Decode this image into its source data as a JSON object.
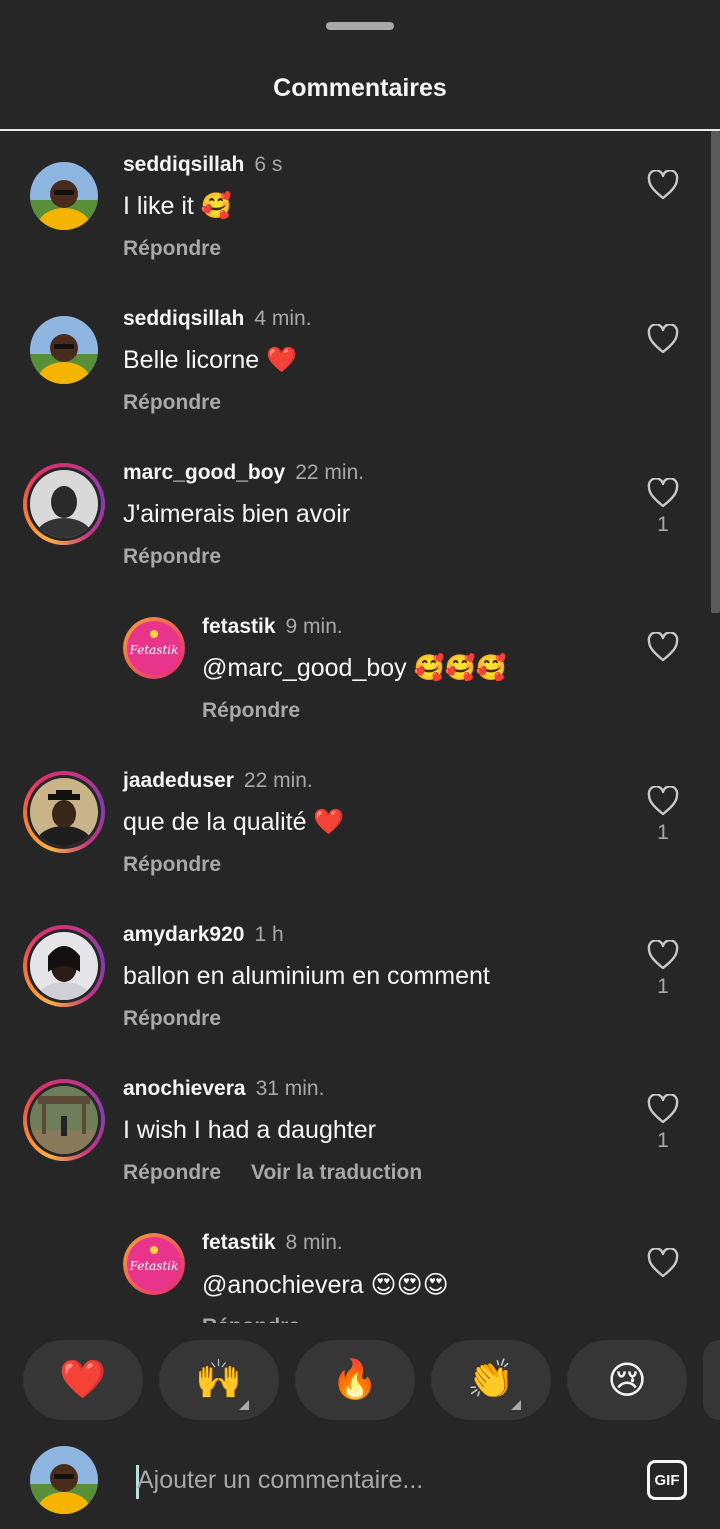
{
  "header": {
    "title": "Commentaires"
  },
  "comments": [
    {
      "username": "seddiqsillah",
      "time": "6 s",
      "text": "I like it 🥰",
      "reply": "Répondre",
      "likes": ""
    },
    {
      "username": "seddiqsillah",
      "time": "4 min.",
      "text": "Belle licorne ❤️",
      "reply": "Répondre",
      "likes": ""
    },
    {
      "username": "marc_good_boy",
      "time": "22 min.",
      "text": "J'aimerais bien avoir",
      "reply": "Répondre",
      "likes": "1"
    },
    {
      "username": "fetastik",
      "time": "9 min.",
      "text": "@marc_good_boy 🥰🥰🥰",
      "reply": "Répondre",
      "likes": ""
    },
    {
      "username": "jaadeduser",
      "time": "22 min.",
      "text": "que de la qualité ❤️",
      "reply": "Répondre",
      "likes": "1"
    },
    {
      "username": "amydark920",
      "time": "1 h",
      "text": "ballon en aluminium en comment",
      "reply": "Répondre",
      "likes": "1"
    },
    {
      "username": "anochievera",
      "time": "31 min.",
      "text": "I wish I had a daughter",
      "reply": "Répondre",
      "translate": "Voir la traduction",
      "likes": "1"
    },
    {
      "username": "fetastik",
      "time": "8 min.",
      "text": "@anochievera 😍😍😍",
      "reply": "Répondre",
      "likes": ""
    }
  ],
  "quick_reactions": [
    "❤️",
    "🙌",
    "🔥",
    "👏",
    "😢"
  ],
  "composer": {
    "placeholder": "Ajouter un commentaire...",
    "gif_label": "GIF"
  },
  "avatar_logo_text": "Fetastik",
  "colors": {
    "background": "#262626",
    "secondary_text": "#a8a8a8",
    "heart_red": "#ed1b24"
  }
}
